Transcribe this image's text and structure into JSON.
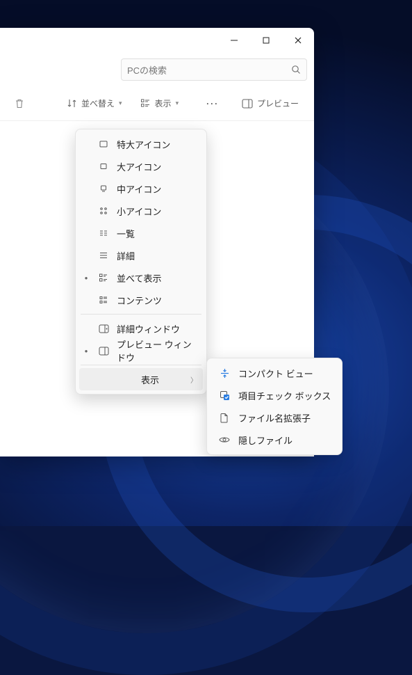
{
  "window_controls": {
    "minimize": "minimize",
    "maximize": "maximize",
    "close": "close"
  },
  "search": {
    "placeholder": "PCの検索"
  },
  "toolbar": {
    "delete": "削除",
    "sort": "並べ替え",
    "view": "表示",
    "more": "...",
    "preview": "プレビュー"
  },
  "view_menu": {
    "items": [
      {
        "label": "特大アイコン"
      },
      {
        "label": "大アイコン"
      },
      {
        "label": "中アイコン"
      },
      {
        "label": "小アイコン"
      },
      {
        "label": "一覧"
      },
      {
        "label": "詳細"
      },
      {
        "label": "並べて表示",
        "selected": true
      },
      {
        "label": "コンテンツ"
      }
    ],
    "panes": [
      {
        "label": "詳細ウィンドウ"
      },
      {
        "label": "プレビュー ウィンドウ",
        "selected": true
      }
    ],
    "show": {
      "label": "表示"
    }
  },
  "show_submenu": {
    "items": [
      {
        "label": "コンパクト ビュー"
      },
      {
        "label": "項目チェック ボックス",
        "checked": true
      },
      {
        "label": "ファイル名拡張子"
      },
      {
        "label": "隠しファイル"
      }
    ]
  }
}
